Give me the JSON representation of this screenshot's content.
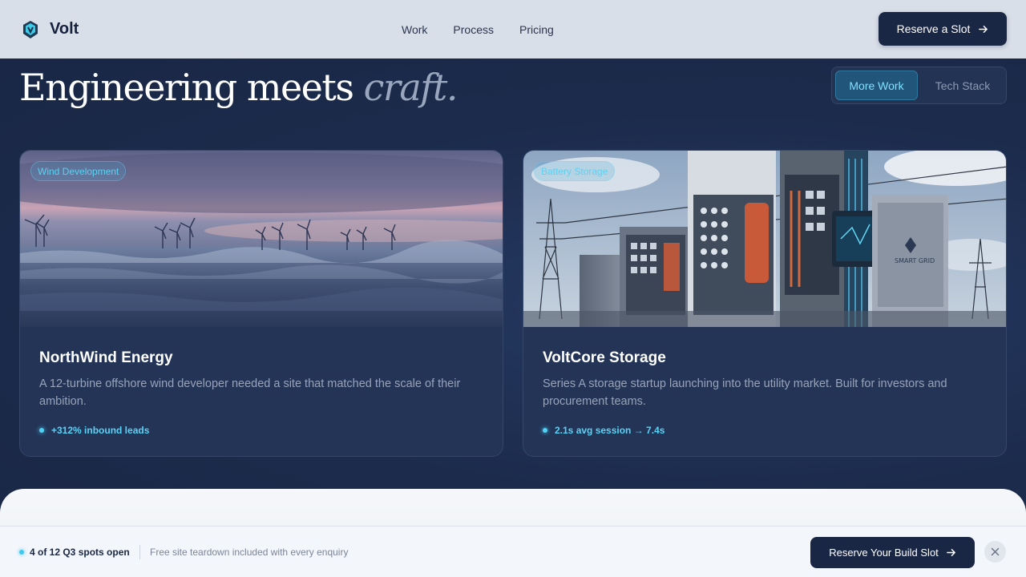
{
  "header": {
    "brand": "Volt",
    "nav": [
      "Work",
      "Process",
      "Pricing"
    ],
    "cta_label": "Reserve a Slot"
  },
  "hero": {
    "headline_main": "Engineering meets",
    "headline_accent": "craft."
  },
  "toggle": {
    "active_label": "More Work",
    "inactive_label": "Tech Stack"
  },
  "cards": [
    {
      "badge": "Wind Development",
      "title": "NorthWind Energy",
      "description": "A 12-turbine offshore wind developer needed a site that matched the scale of their ambition.",
      "metric": "+312% inbound leads"
    },
    {
      "badge": "Battery Storage",
      "title": "VoltCore Storage",
      "description": "Series A storage startup launching into the utility market. Built for investors and procurement teams.",
      "metric": "2.1s avg session → 7.4s"
    }
  ],
  "bottom_bar": {
    "spots": "4 of 12 Q3 spots open",
    "note": "Free site teardown included with every enquiry",
    "cta_label": "Reserve Your Build Slot"
  },
  "colors": {
    "accent": "#50d2f7",
    "navy": "#1a2744",
    "background": "#1b2a4a"
  },
  "icons": {
    "logo": "volt-logo-icon",
    "cta": "arrow-right-icon",
    "close": "close-icon"
  }
}
